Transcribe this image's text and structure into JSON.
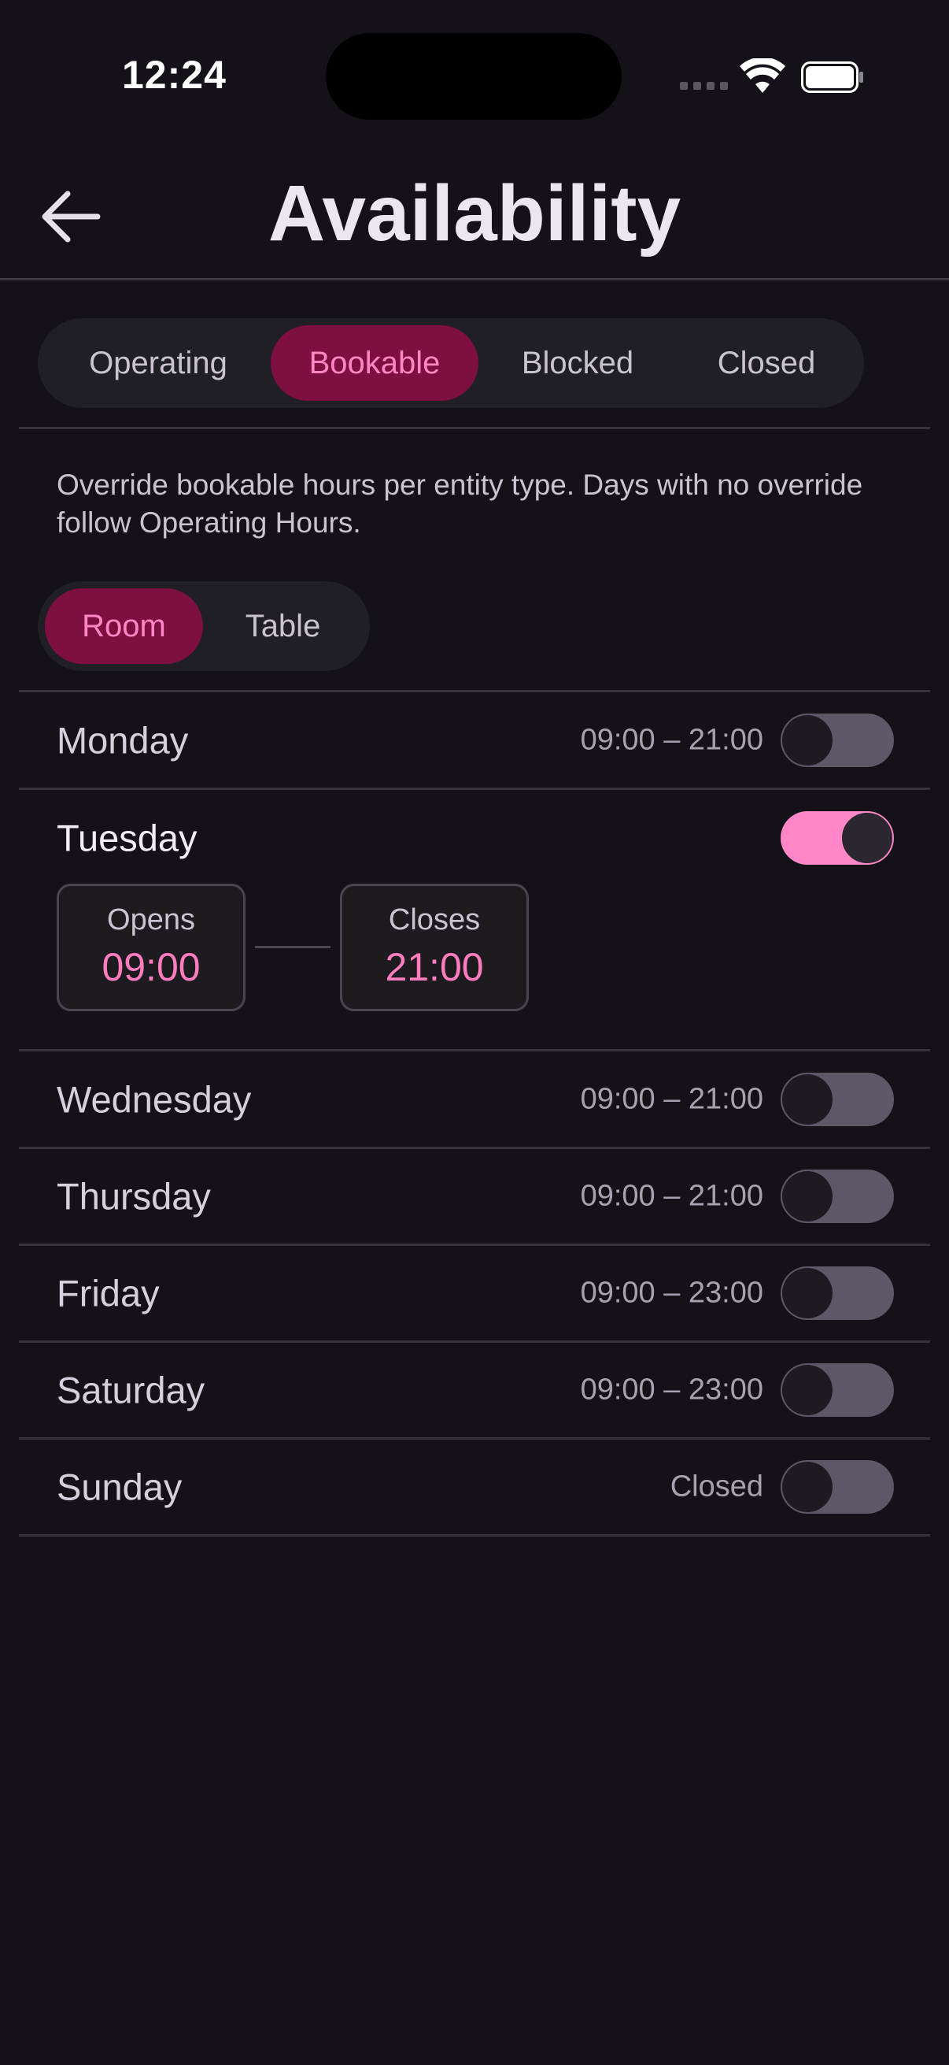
{
  "status_bar": {
    "time": "12:24"
  },
  "header": {
    "title": "Availability"
  },
  "tabs": [
    {
      "label": "Operating",
      "active": false
    },
    {
      "label": "Bookable",
      "active": true
    },
    {
      "label": "Blocked",
      "active": false
    },
    {
      "label": "Closed",
      "active": false
    }
  ],
  "description": "Override bookable hours per entity type. Days with no override follow Operating Hours.",
  "entity_types": [
    {
      "label": "Room",
      "active": true
    },
    {
      "label": "Table",
      "active": false
    }
  ],
  "days": [
    {
      "name": "Monday",
      "hours": "09:00 – 21:00",
      "override": false
    },
    {
      "name": "Tuesday",
      "hours": "",
      "override": true
    },
    {
      "name": "Wednesday",
      "hours": "09:00 – 21:00",
      "override": false
    },
    {
      "name": "Thursday",
      "hours": "09:00 – 21:00",
      "override": false
    },
    {
      "name": "Friday",
      "hours": "09:00 – 23:00",
      "override": false
    },
    {
      "name": "Saturday",
      "hours": "09:00 – 23:00",
      "override": false
    },
    {
      "name": "Sunday",
      "hours": "Closed",
      "override": false
    }
  ],
  "tuesday_editor": {
    "opens_label": "Opens",
    "opens_value": "09:00",
    "closes_label": "Closes",
    "closes_value": "21:00"
  },
  "colors": {
    "background": "#141218",
    "accent": "#ff86c4",
    "accent_container": "#7d1040",
    "toggle_off": "#5d5868"
  },
  "icons": {
    "back": "arrow-left-icon",
    "wifi": "wifi-icon",
    "battery": "battery-icon",
    "signal": "cellular-signal-icon"
  }
}
